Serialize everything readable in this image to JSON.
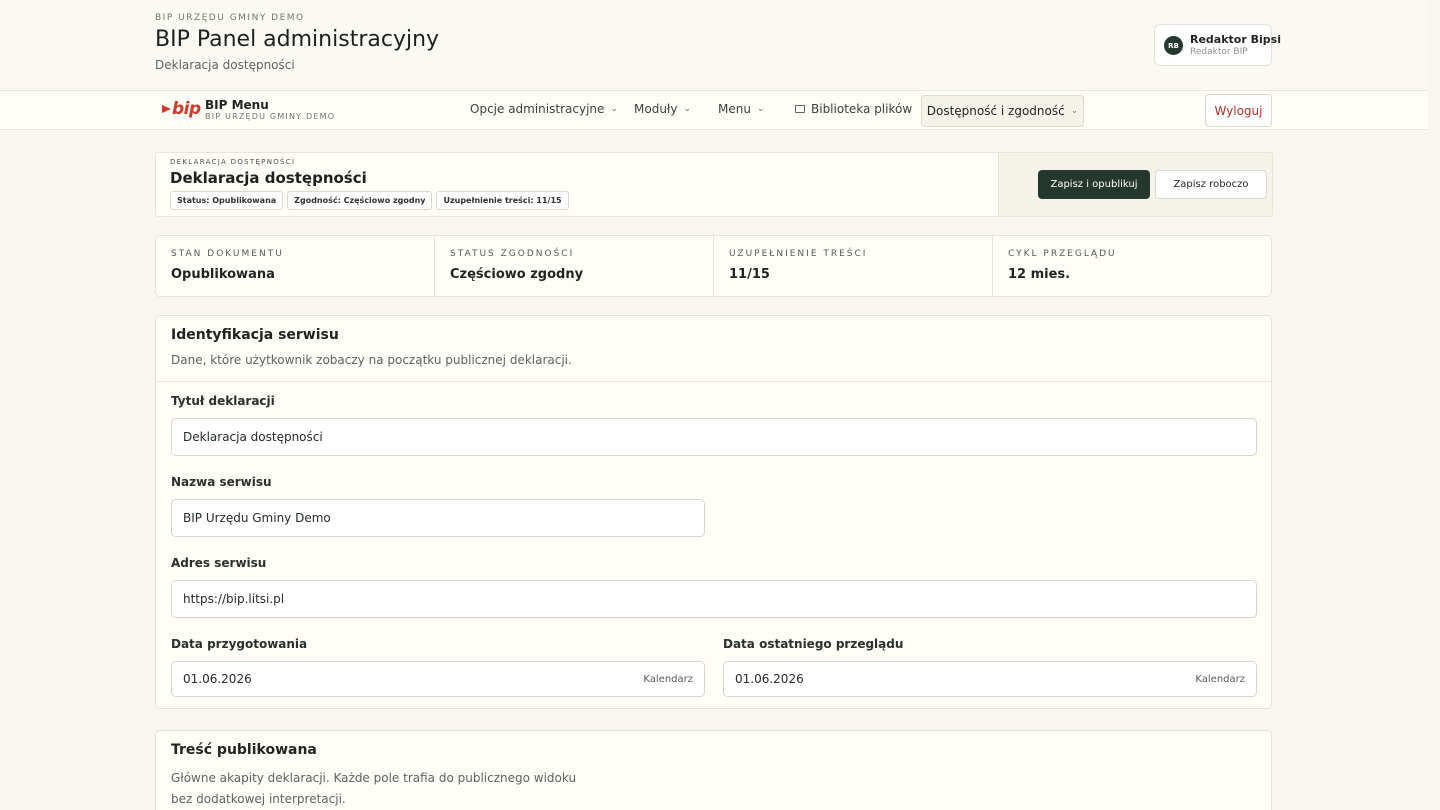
{
  "header": {
    "org_small": "BIP URZĘDU GMINY DEMO",
    "title": "BIP Panel administracyjny",
    "subtitle": "Deklaracja dostępności",
    "user": {
      "initials": "RB",
      "name": "Redaktor Bipsi",
      "role": "Redaktor BIP"
    }
  },
  "nav": {
    "logo_text": "bip",
    "brand_title": "BIP Menu",
    "brand_sub": "BIP URZĘDU GMINY DEMO",
    "items": [
      {
        "label": "Opcje administracyjne"
      },
      {
        "label": "Moduły"
      },
      {
        "label": "Menu"
      },
      {
        "label": "Biblioteka plików"
      }
    ],
    "active_label": "Dostępność i zgodność",
    "logout_label": "Wyloguj"
  },
  "doc": {
    "kicker": "DEKLARACJA DOSTĘPNOŚCI",
    "title": "Deklaracja dostępności",
    "badges": [
      "Status: Opublikowana",
      "Zgodność: Częściowo zgodny",
      "Uzupełnienie treści: 11/15"
    ],
    "publish_label": "Zapisz i opublikuj",
    "draft_label": "Zapisz roboczo"
  },
  "stats": [
    {
      "label": "Stan dokumentu",
      "value": "Opublikowana"
    },
    {
      "label": "Status zgodności",
      "value": "Częściowo zgodny"
    },
    {
      "label": "Uzupełnienie treści",
      "value": "11/15"
    },
    {
      "label": "Cykl przeglądu",
      "value": "12 mies."
    }
  ],
  "identification": {
    "title": "Identyfikacja serwisu",
    "description": "Dane, które użytkownik zobaczy na początku publicznej deklaracji.",
    "fields": {
      "title_label": "Tytuł deklaracji",
      "title_value": "Deklaracja dostępności",
      "name_label": "Nazwa serwisu",
      "name_value": "BIP Urzędu Gminy Demo",
      "address_label": "Adres serwisu",
      "address_value": "https://bip.litsi.pl",
      "prep_date_label": "Data przygotowania",
      "prep_date_value": "01.06.2026",
      "review_date_label": "Data ostatniego przeglądu",
      "review_date_value": "01.06.2026",
      "calendar_label": "Kalendarz"
    }
  },
  "published": {
    "title": "Treść publikowana",
    "description": "Główne akapity deklaracji. Każde pole trafia do publicznego widoku bez dodatkowej interpretacji."
  }
}
